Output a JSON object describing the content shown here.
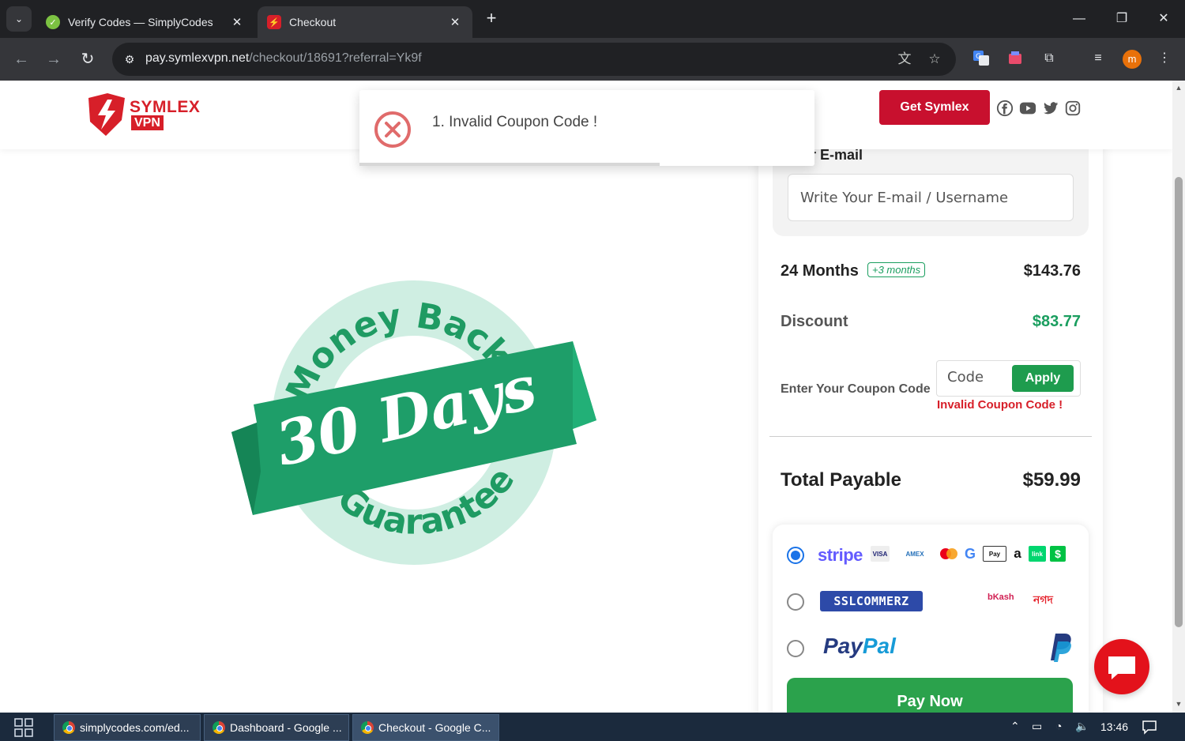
{
  "browser": {
    "tabs": [
      {
        "title": "Verify Codes — SimplyCodes",
        "favicon": "simplycodes-icon",
        "active": false
      },
      {
        "title": "Checkout",
        "favicon": "symlex-icon",
        "active": true
      }
    ],
    "url_host": "pay.symlexvpn.net",
    "url_path": "/checkout/18691?referral=Yk9f",
    "profile_initial": "m"
  },
  "header": {
    "logo_line1": "SYMLEX",
    "logo_line2": "VPN",
    "cta_label": "Get Symlex",
    "social_icons": [
      "facebook-icon",
      "youtube-icon",
      "twitter-icon",
      "instagram-icon"
    ]
  },
  "toast": {
    "message": "1. Invalid Coupon Code !",
    "progress": 0.66
  },
  "hero": {
    "arc_top": "Money Back",
    "ribbon": "30 Days",
    "arc_bottom": "Guarantee"
  },
  "checkout": {
    "email_label_visible": "r E-mail",
    "email_placeholder": "Write Your E-mail / Username",
    "plan_label": "24 Months",
    "plan_bonus": "+3 months",
    "plan_price": "$143.76",
    "discount_label": "Discount",
    "discount_value": "$83.77",
    "coupon_label": "Enter Your Coupon Code",
    "coupon_placeholder": "Code",
    "apply_label": "Apply",
    "coupon_error": "Invalid Coupon Code !",
    "total_label": "Total Payable",
    "total_value": "$59.99",
    "payment_methods": [
      {
        "name": "stripe",
        "selected": true
      },
      {
        "name": "sslcommerz",
        "selected": false
      },
      {
        "name": "PayPal",
        "selected": false
      }
    ],
    "stripe_label": "stripe",
    "sslcommerz_label": "SSLCOMMERZ",
    "bkash_label": "bKash",
    "nagad_label": "নগদ",
    "paypal_part1": "Pay",
    "paypal_part2": "Pal",
    "pay_now_label": "Pay Now"
  },
  "taskbar": {
    "items": [
      {
        "label": "simplycodes.com/ed...",
        "active": false
      },
      {
        "label": "Dashboard - Google ...",
        "active": false
      },
      {
        "label": "Checkout - Google C...",
        "active": true
      }
    ],
    "time": "13:46"
  },
  "colors": {
    "brand_red": "#d71f29",
    "success_green": "#1a9e5f",
    "button_green": "#2ba24c"
  }
}
